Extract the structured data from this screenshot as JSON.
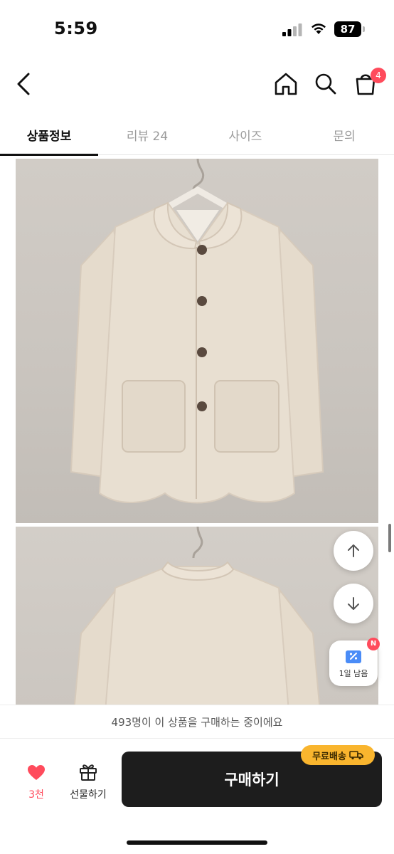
{
  "status_bar": {
    "time": "5:59",
    "battery": "87"
  },
  "nav": {
    "cart_badge": "4"
  },
  "tabs": [
    {
      "label": "상품정보",
      "active": true
    },
    {
      "label": "리뷰 24",
      "active": false
    },
    {
      "label": "사이즈",
      "active": false
    },
    {
      "label": "문의",
      "active": false
    }
  ],
  "coupon": {
    "badge": "N",
    "label": "1일 남음"
  },
  "notice": "493명이 이 상품을 구매하는 중이에요",
  "bottom": {
    "like_count": "3천",
    "gift_label": "선물하기",
    "buy_label": "구매하기",
    "free_shipping": "무료배송"
  },
  "colors": {
    "accent_red": "#ff4b5c",
    "buy_button": "#1d1d1d",
    "free_shipping_badge": "#f9b52e",
    "coat": "#e6dccd"
  }
}
